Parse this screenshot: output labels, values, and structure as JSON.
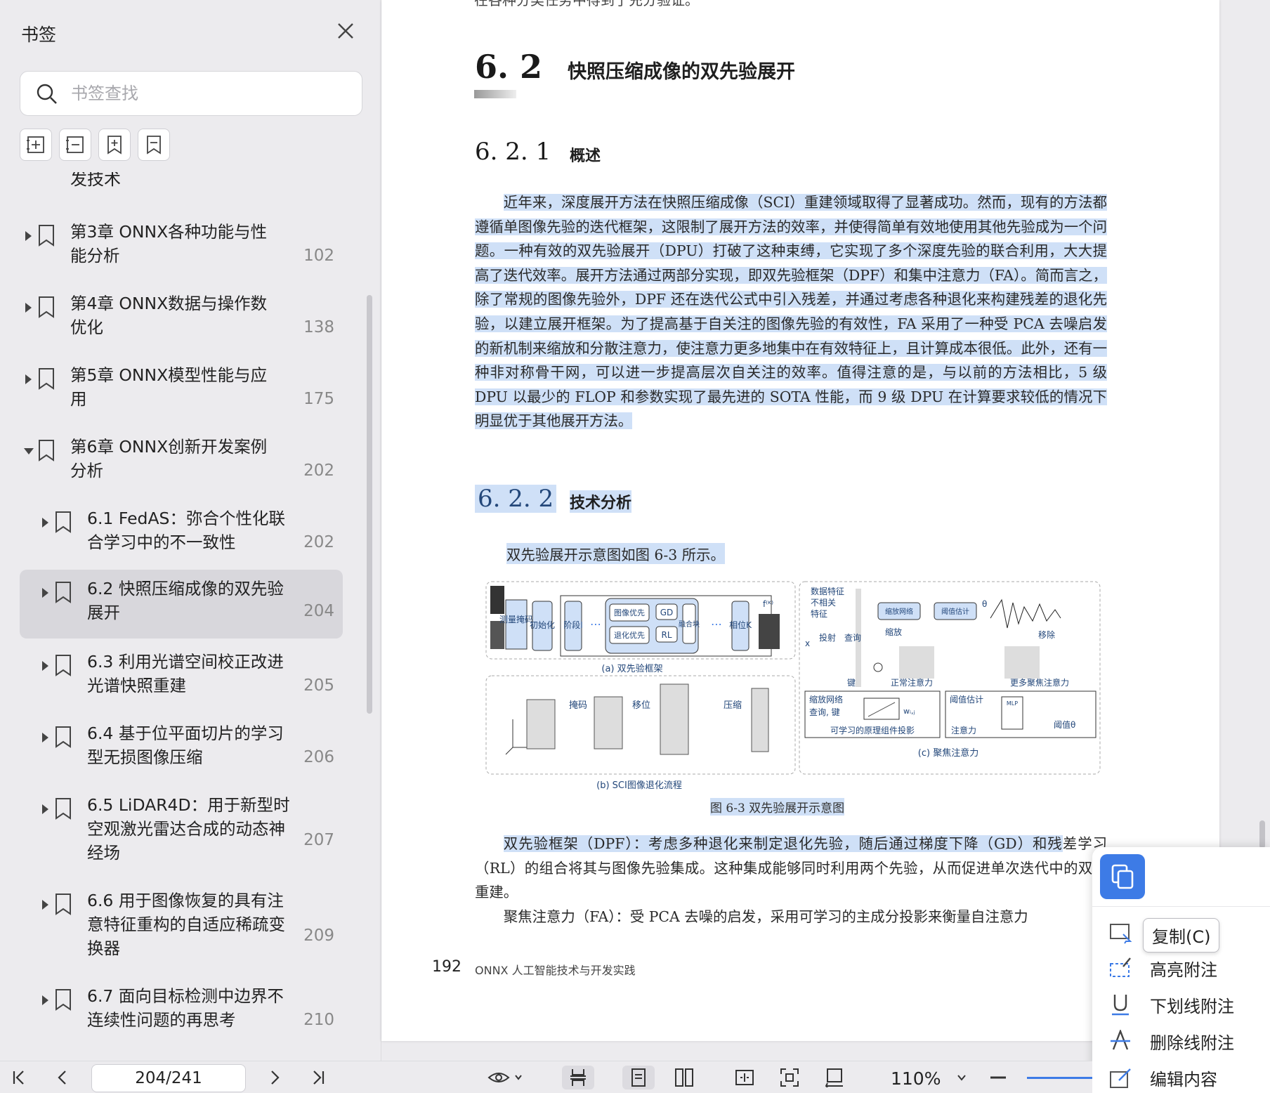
{
  "sidebar": {
    "title": "书签",
    "search_placeholder": "书签查找",
    "cut_text": "发技术",
    "items": [
      {
        "label": "第3章   ONNX各种功能与性能分析",
        "page": "102"
      },
      {
        "label": "第4章   ONNX数据与操作数优化",
        "page": "138"
      },
      {
        "label": "第5章   ONNX模型性能与应用",
        "page": "175"
      },
      {
        "label": "第6章   ONNX创新开发案例分析",
        "page": "202"
      },
      {
        "label": "6.1   FedAS：弥合个性化联合学习中的不一致性",
        "page": "202"
      },
      {
        "label": "6.2   快照压缩成像的双先验展开",
        "page": "204"
      },
      {
        "label": "6.3   利用光谱空间校正改进光谱快照重建",
        "page": "205"
      },
      {
        "label": "6.4   基于位平面切片的学习型无损图像压缩",
        "page": "206"
      },
      {
        "label": "6.5   LiDAR4D：用于新型时空观激光雷达合成的动态神经场",
        "page": "207"
      },
      {
        "label": "6.6   用于图像恢复的具有注意特征重构的自适应稀疏变换器",
        "page": "209"
      },
      {
        "label": "6.7   面向目标检测中边界不连续性问题的再思考",
        "page": "210"
      }
    ]
  },
  "document": {
    "top_cut": "在各种分类任务中得到了充分验证。",
    "h1_num": "6. 2",
    "h1_title": "快照压缩成像的双先验展开",
    "h2_num": "6. 2. 1",
    "h2_title": "概述",
    "para1": "近年来，深度展开方法在快照压缩成像（SCI）重建领域取得了显著成功。然而，现有的方法都遵循单图像先验的迭代框架，这限制了展开方法的效率，并使得简单有效地使用其他先验成为一个问题。一种有效的双先验展开（DPU）打破了这种束缚，它实现了多个深度先验的联合利用，大大提高了迭代效率。展开方法通过两部分实现，即双先验框架（DPF）和集中注意力（FA）。简而言之，除了常规的图像先验外，DPF 还在迭代公式中引入残差，并通过考虑各种退化来构建残差的退化先验，以建立展开框架。为了提高基于自关注的图像先验的有效性，FA 采用了一种受 PCA 去噪启发的新机制来缩放和分散注意力，使注意力更多地集中在有效特征上，且计算成本很低。此外，还有一种非对称骨干网，可以进一步提高层次自关注的效率。值得注意的是，与以前的方法相比，5 级 DPU 以最少的 FLOP 和参数实现了最先进的 SOTA 性能，而 9 级 DPU 在计算要求较低的情况下明显优于其他展开方法。",
    "h3_num": "6. 2. 2",
    "h3_title": "技术分析",
    "fig_ref": "双先验展开示意图如图 6-3 所示。",
    "fig_caption": "图 6-3   双先验展开示意图",
    "fig_labels": {
      "measure": "测量掩码",
      "init": "初始化",
      "stage1": "阶段Ⅰ",
      "img_prior": "图像优先",
      "deg_prior": "退化优先",
      "gd": "GD",
      "rl": "RL",
      "fuse": "融合块",
      "stagek": "相位K",
      "fk": "f⁽ᴷ⁾",
      "dots": "⋯",
      "a": "(a) 双先验框架",
      "mask": "掩码",
      "shift": "移位",
      "compress": "压缩",
      "b": "(b) SCI图像退化流程",
      "feat1": "数据特征",
      "feat2": "不相关",
      "feat3": "特征",
      "scale_net": "缩放网络",
      "thr_est": "阈值估计",
      "theta": "θ",
      "remove": "移除",
      "scale": "缩放",
      "proj": "投射",
      "query": "查询",
      "key": "键",
      "x": "x",
      "normal_att": "正常注意力",
      "more_att": "更多聚焦注意力",
      "sn2": "缩放网络",
      "qk": "查询, 键",
      "w": "wᵢ,ⱼ",
      "learn_proj": "可学习的原理组件投影",
      "te2": "阈值估计",
      "mlp": "MLP",
      "thr": "阈值θ",
      "att2": "注意力",
      "c": "(c) 聚焦注意力"
    },
    "para2_l1": "双先验框架（DPF）：考虑多种退化来制定退化先验，随后通过梯度下降（GD）和残",
    "para2_rest": "差学习（RL）的组合将其与图像先验集成。这种集成能够同时利用两个先验，从而促进单次迭代中的双重重建。",
    "para3": "聚焦注意力（FA）：受 PCA 去噪的启发，采用可学习的主成分投影来衡量自注意力",
    "footer_page": "192",
    "footer_title": "ONNX 人工智能技术与开发实践"
  },
  "context_menu": {
    "tooltip": "复制(C)",
    "items": [
      {
        "label": "高亮附注"
      },
      {
        "label": "下划线附注"
      },
      {
        "label": "删除线附注"
      },
      {
        "label": "编辑内容"
      }
    ]
  },
  "toolbar": {
    "page_value": "204/241",
    "zoom": "110%"
  },
  "colors": {
    "accent": "#3d7be6",
    "highlight": "#cfe0f7"
  }
}
